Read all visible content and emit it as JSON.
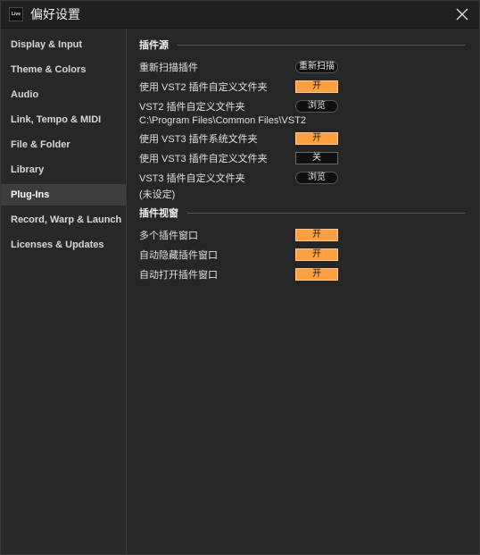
{
  "window": {
    "title": "偏好设置",
    "app_icon_text": "Live"
  },
  "sidebar": {
    "items": [
      {
        "label": "Display & Input"
      },
      {
        "label": "Theme & Colors"
      },
      {
        "label": "Audio"
      },
      {
        "label": "Link, Tempo & MIDI"
      },
      {
        "label": "File & Folder"
      },
      {
        "label": "Library"
      },
      {
        "label": "Plug-Ins",
        "active": true
      },
      {
        "label": "Record, Warp & Launch"
      },
      {
        "label": "Licenses & Updates"
      }
    ]
  },
  "plugin_sources": {
    "heading": "插件源",
    "rescan_label": "重新扫描插件",
    "rescan_button": "重新扫描",
    "vst2_custom_use_label": "使用 VST2 插件自定义文件夹",
    "vst2_custom_use_value": "开",
    "vst2_folder_label": "VST2 插件自定义文件夹",
    "vst2_browse_button": "浏览",
    "vst2_folder_path": "C:\\Program Files\\Common Files\\VST2",
    "vst3_system_label": "使用 VST3 插件系统文件夹",
    "vst3_system_value": "开",
    "vst3_custom_use_label": "使用 VST3 插件自定义文件夹",
    "vst3_custom_use_value": "关",
    "vst3_folder_label": "VST3 插件自定义文件夹",
    "vst3_browse_button": "浏览",
    "vst3_folder_path": "(未设定)"
  },
  "plugin_windows": {
    "heading": "插件视窗",
    "multi_label": "多个插件窗口",
    "multi_value": "开",
    "auto_hide_label": "自动隐藏插件窗口",
    "auto_hide_value": "开",
    "auto_open_label": "自动打开插件窗口",
    "auto_open_value": "开"
  },
  "colors": {
    "accent_on": "#ffa040",
    "background": "#262626"
  }
}
